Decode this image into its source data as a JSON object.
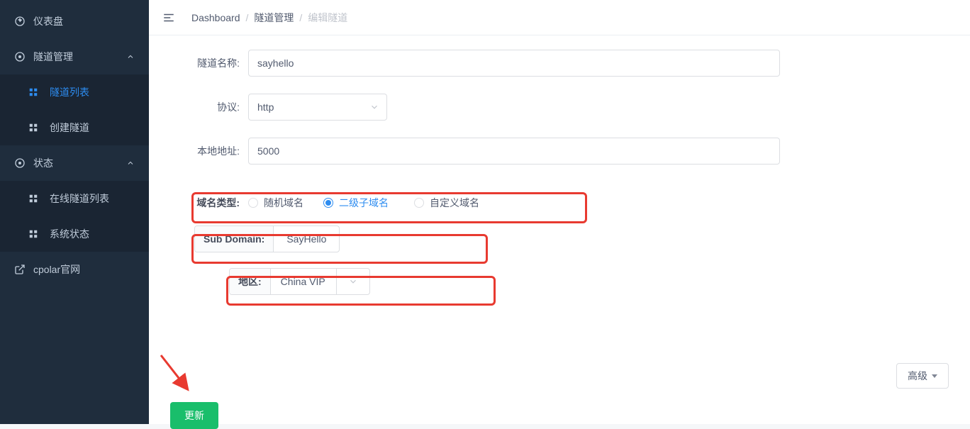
{
  "sidebar": {
    "items": [
      {
        "label": "仪表盘",
        "icon": "dashboard"
      },
      {
        "label": "隧道管理",
        "icon": "tunnel",
        "expandable": true
      },
      {
        "label": "隧道列表",
        "sub": true,
        "active": true
      },
      {
        "label": "创建隧道",
        "sub": true
      },
      {
        "label": "状态",
        "icon": "status",
        "expandable": true
      },
      {
        "label": "在线隧道列表",
        "sub": true
      },
      {
        "label": "系统状态",
        "sub": true
      },
      {
        "label": "cpolar官网",
        "icon": "external"
      }
    ]
  },
  "breadcrumb": {
    "items": [
      "Dashboard",
      "隧道管理",
      "编辑隧道"
    ]
  },
  "form": {
    "tunnel_name": {
      "label": "隧道名称:",
      "value": "sayhello"
    },
    "protocol": {
      "label": "协议:",
      "value": "http"
    },
    "local_addr": {
      "label": "本地地址:",
      "value": "5000"
    },
    "domain_type": {
      "label": "域名类型:",
      "options": [
        "随机域名",
        "二级子域名",
        "自定义域名"
      ],
      "selected": "二级子域名"
    },
    "sub_domain": {
      "label": "Sub Domain:",
      "value": "SayHello"
    },
    "region": {
      "label": "地区:",
      "value": "China VIP"
    },
    "advanced_label": "高级",
    "update_label": "更新"
  }
}
